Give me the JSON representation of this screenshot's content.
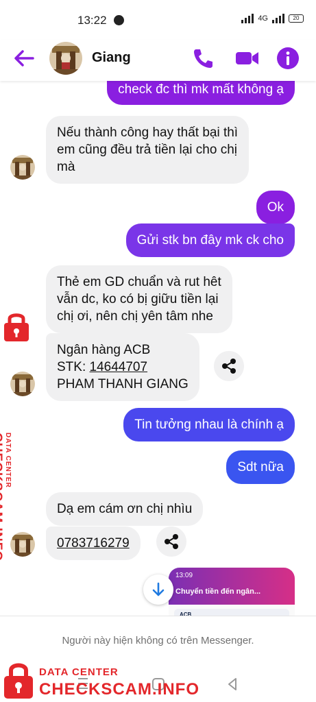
{
  "status_bar": {
    "time": "13:22",
    "network": "4G",
    "battery": "20"
  },
  "header": {
    "contact_name": "Giang"
  },
  "messages": [
    {
      "from": "me",
      "text": "check đc thì mk mất không ạ"
    },
    {
      "from": "them",
      "lines": [
        "Nếu thành công hay thất bại thì",
        "em cũng đều trả tiền lại cho chị",
        "mà"
      ]
    },
    {
      "from": "me",
      "text": "Ok"
    },
    {
      "from": "me",
      "text": "Gửi stk bn đây mk ck cho"
    },
    {
      "from": "them",
      "lines": [
        "Thẻ em GD chuẩn và rut hêt",
        "vẫn dc,  ko có bị giữu tiền lại",
        "chị ơi,  nên chị yên tâm nhe"
      ]
    },
    {
      "from": "them",
      "bank_line": "Ngân hàng ACB",
      "stk_label": "STK: ",
      "stk_number": "14644707",
      "account_name": "PHAM THANH GIANG"
    },
    {
      "from": "me",
      "text": "Tin tưởng nhau là chính ạ"
    },
    {
      "from": "me",
      "text": "Sdt nữa"
    },
    {
      "from": "them",
      "text": "Dạ em cám ơn chị nhìu"
    },
    {
      "from": "them",
      "phone": "0783716279"
    }
  ],
  "image_preview": {
    "time": "13:09",
    "title": "Chuyển tiền đến ngân...",
    "bank": "ACB"
  },
  "footer": {
    "unavailable_text": "Người này hiện không có trên Messenger."
  },
  "watermark": {
    "line1": "DATA CENTER",
    "line2": "CHECKSCAM.INFO"
  },
  "colors": {
    "purple": "#8a1fe0",
    "blue": "#3a55f0",
    "brand_red": "#e3272b"
  }
}
